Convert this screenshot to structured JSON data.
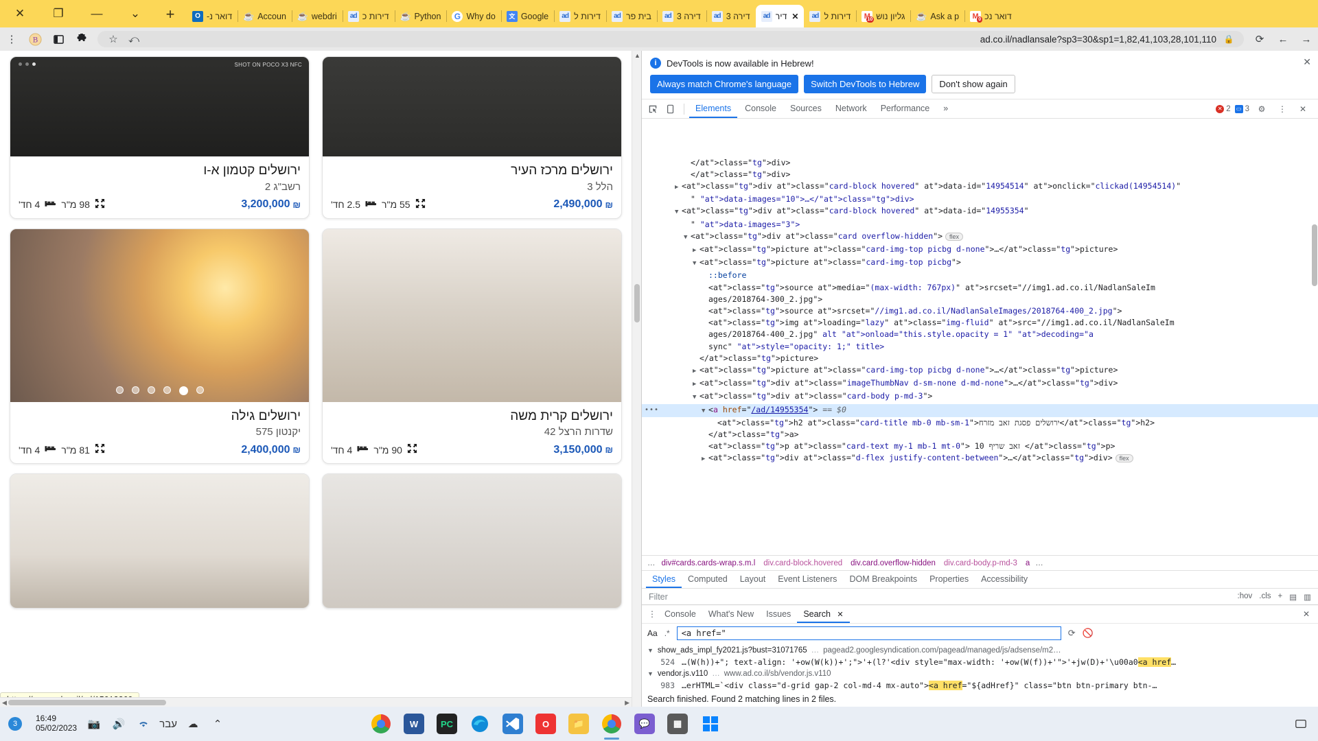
{
  "browser": {
    "window_controls": [
      "close-x",
      "restore",
      "minimize",
      "chevron"
    ],
    "new_tab_label": "+",
    "tabs": [
      {
        "label": "דואר נ-",
        "icon": "outlook-icon",
        "active": false
      },
      {
        "label": "Accoun",
        "icon": "java-icon",
        "active": false
      },
      {
        "label": "webdri",
        "icon": "java-icon",
        "active": false
      },
      {
        "label": "דירות כ",
        "icon": "ad-icon",
        "active": false
      },
      {
        "label": "Python",
        "icon": "java-icon",
        "active": false
      },
      {
        "label": "Why do",
        "icon": "google-icon",
        "active": false
      },
      {
        "label": "Google",
        "icon": "google-translate-icon",
        "active": false
      },
      {
        "label": "דירות ל",
        "icon": "ad-icon",
        "active": false
      },
      {
        "label": "בית פר",
        "icon": "ad-icon",
        "active": false
      },
      {
        "label": "דירה 3",
        "icon": "ad-icon",
        "active": false
      },
      {
        "label": "דירה 3",
        "icon": "ad-icon",
        "active": false
      },
      {
        "label": "דיר",
        "icon": "ad-icon",
        "active": true,
        "close": "✕"
      },
      {
        "label": "דירות ל",
        "icon": "ad-icon",
        "active": false
      },
      {
        "label": "גליון נוש",
        "icon": "gmail-icon",
        "badge": "10",
        "active": false
      },
      {
        "label": "Ask a p",
        "icon": "java-icon",
        "active": false
      },
      {
        "label": "דואר נכ",
        "icon": "gmail-icon",
        "badge": "0",
        "active": false
      }
    ],
    "toolbar_icons": [
      "kebab-menu-icon",
      "profile-icon",
      "sidepanel-icon",
      "extensions-icon",
      "star-icon",
      "share-icon"
    ],
    "url": "ad.co.il/nadlansale?sp3=30&sp1=1,82,41,103,28,101,110",
    "url_host": "ad.co.il",
    "url_path": "/nadlansale?sp3=30&sp1=1,82,41,103,28,101,110",
    "lock_icon": "lock-icon",
    "reload_icon": "reload-icon",
    "back_icon": "back-arrow-icon",
    "forward_icon": "forward-arrow-icon"
  },
  "page": {
    "status_link": "https://www.ad.co.il/ad/15013369",
    "cards": [
      {
        "title": "ירושלים מרכז העיר",
        "subtitle": "הלל 3",
        "price": "2,490,000",
        "currency": "₪",
        "rooms": "2.5 חד'",
        "size": "55 מ\"ר",
        "image": "img-kitchen-a",
        "expand_icon": "expand-icon",
        "bed_icon": "bed-icon"
      },
      {
        "title": "ירושלים קטמון א-ו",
        "subtitle": "רשב\"ג 2",
        "price": "3,200,000",
        "currency": "₪",
        "rooms": "4 חד'",
        "size": "98 מ\"ר",
        "image": "img-darkroom",
        "badge": "SHOT ON POCO X3 NFC",
        "expand_icon": "expand-icon",
        "bed_icon": "bed-icon"
      },
      {
        "title": "ירושלים קרית משה",
        "subtitle": "שדרות הרצל 42",
        "price": "3,150,000",
        "currency": "₪",
        "rooms": "4 חד'",
        "size": "90 מ\"ר",
        "image": "img-kitchen-b",
        "expand_icon": "expand-icon",
        "bed_icon": "bed-icon"
      },
      {
        "title": "ירושלים גילה",
        "subtitle": "יקנטון 575",
        "price": "2,400,000",
        "currency": "₪",
        "rooms": "4 חד'",
        "size": "81 מ\"ר",
        "image": "img-balcony",
        "dots": 6,
        "active_dot": 1,
        "expand_icon": "expand-icon",
        "bed_icon": "bed-icon"
      },
      {
        "title": "",
        "subtitle": "",
        "price": "",
        "image": "img-tiles"
      },
      {
        "title": "",
        "subtitle": "",
        "price": "",
        "image": "img-livingroom"
      }
    ]
  },
  "devtools": {
    "banner": {
      "message": "DevTools is now available in Hebrew!",
      "primary_button": "Always match Chrome's language",
      "secondary_button": "Switch DevTools to Hebrew",
      "dismiss_button": "Don't show again",
      "close_icon": "close-icon",
      "info_icon": "info-icon"
    },
    "tabs": [
      "Elements",
      "Console",
      "Sources",
      "Network",
      "Performance"
    ],
    "active_tab": "Elements",
    "overflow_icon": "chevron-right-icon",
    "inspect_icon": "inspect-icon",
    "device_icon": "device-toolbar-icon",
    "settings_icon": "gear-icon",
    "more_icon": "kebab-menu-icon",
    "close_icon": "close-icon",
    "error_count": "2",
    "message_count": "3",
    "dom_lines": [
      {
        "indent": 3,
        "twisty": "",
        "html": "&lt;/div&gt;",
        "type": "text"
      },
      {
        "indent": 3,
        "twisty": "",
        "html": "&lt;/div&gt;",
        "type": "text"
      },
      {
        "indent": 2,
        "twisty": "▶",
        "html": "&lt;div class=\"card-block hovered\" data-id=\"14954514\" onclick=\"clickad(14954514)\"",
        "type": "tag"
      },
      {
        "indent": 3,
        "twisty": "",
        "html": "\" data-images=\"10\"&gt;…&lt;/div&gt;",
        "type": "tag"
      },
      {
        "indent": 2,
        "twisty": "▼",
        "html": "&lt;div class=\"card-block hovered\" data-id=\"14955354\"",
        "type": "tag"
      },
      {
        "indent": 3,
        "twisty": "",
        "html": "\" data-images=\"3\"&gt;",
        "type": "tag"
      },
      {
        "indent": 3,
        "twisty": "▼",
        "html": "&lt;div class=\"card overflow-hidden\"&gt;",
        "type": "tag",
        "flex": true
      },
      {
        "indent": 4,
        "twisty": "▶",
        "html": "&lt;picture class=\"card-img-top picbg d-none\"&gt;…&lt;/picture&gt;",
        "type": "tag"
      },
      {
        "indent": 4,
        "twisty": "▼",
        "html": "&lt;picture class=\"card-img-top picbg\"&gt;",
        "type": "tag"
      },
      {
        "indent": 5,
        "twisty": "",
        "html": "::before",
        "type": "pseudo"
      },
      {
        "indent": 5,
        "twisty": "",
        "html": "&lt;source media=\"(max-width: 767px)\" srcset=\"//img1.ad.co.il/NadlanSaleIm",
        "type": "tag"
      },
      {
        "indent": 5,
        "twisty": "",
        "html": "ages/2018764-300_2.jpg\"&gt;",
        "type": "tag"
      },
      {
        "indent": 5,
        "twisty": "",
        "html": "&lt;source srcset=\"//img1.ad.co.il/NadlanSaleImages/2018764-400_2.jpg\"&gt;",
        "type": "tag"
      },
      {
        "indent": 5,
        "twisty": "",
        "html": "&lt;img loading=\"lazy\" class=\"img-fluid\" src=\"//img1.ad.co.il/NadlanSaleIm",
        "type": "tag"
      },
      {
        "indent": 5,
        "twisty": "",
        "html": "ages/2018764-400_2.jpg\" alt onload=\"this.style.opacity = 1\" decoding=\"a",
        "type": "tag"
      },
      {
        "indent": 5,
        "twisty": "",
        "html": "sync\" style=\"opacity: 1;\" title&gt;",
        "type": "tag"
      },
      {
        "indent": 4,
        "twisty": "",
        "html": "&lt;/picture&gt;",
        "type": "text"
      },
      {
        "indent": 4,
        "twisty": "▶",
        "html": "&lt;picture class=\"card-img-top picbg d-none\"&gt;…&lt;/picture&gt;",
        "type": "tag"
      },
      {
        "indent": 4,
        "twisty": "▶",
        "html": "&lt;div class=\"imageThumbNav d-sm-none d-md-none\"&gt;…&lt;/div&gt;",
        "type": "tag"
      },
      {
        "indent": 4,
        "twisty": "▼",
        "html": "&lt;div class=\"card-body p-md-3\"&gt;",
        "type": "tag"
      },
      {
        "indent": 5,
        "twisty": "▼",
        "html": "&lt;a href=\"/ad/14955354\"&gt; == $0",
        "type": "selected"
      },
      {
        "indent": 6,
        "twisty": "",
        "html": "&lt;h2 class=\"card-title mb-0 mb-sm-1\"&gt;ירושלים פסגת זאב מזרח&lt;/h2&gt;",
        "type": "tag"
      },
      {
        "indent": 5,
        "twisty": "",
        "html": "&lt;/a&gt;",
        "type": "text"
      },
      {
        "indent": 5,
        "twisty": "",
        "html": "&lt;p class=\"card-text my-1 mb-1 mt-0\"&gt; 10 זאב שריף &lt;/p&gt;",
        "type": "tag"
      },
      {
        "indent": 5,
        "twisty": "▶",
        "html": "&lt;div class=\"d-flex justify-content-between\"&gt;…&lt;/div&gt;",
        "type": "tag",
        "flex": true
      }
    ],
    "breadcrumbs": [
      "div#cards.cards-wrap.s.m.l",
      "div.card-block.hovered",
      "div.card.overflow-hidden",
      "div.card-body.p-md-3",
      "a"
    ],
    "breadcrumb_overflow": "…",
    "style_tabs": [
      "Styles",
      "Computed",
      "Layout",
      "Event Listeners",
      "DOM Breakpoints",
      "Properties",
      "Accessibility"
    ],
    "style_active_tab": "Styles",
    "filter_placeholder": "Filter",
    "hov_label": ":hov",
    "cls_label": ".cls",
    "plus_label": "+",
    "drawer_tabs": [
      "Console",
      "What's New",
      "Issues",
      "Search"
    ],
    "drawer_active_tab": "Search",
    "drawer_close_icon": "close-icon",
    "search": {
      "match_case_icon": "Aa",
      "regex_icon": ".*",
      "query": "<a href=\"",
      "refresh_icon": "refresh-icon",
      "clear_icon": "clear-icon"
    },
    "results": [
      {
        "file": "show_ads_impl_fy2021.js?bust=31071765",
        "url": "pagead2.googlesyndication.com/pagead/managed/js/adsense/m2…",
        "line_no": "524",
        "code_before": "…(W(h))+\"; text-align: '+ow(W(k))+';\">'+(l?'<div style=\"max-width: '+ow(W(f))+'\">'+jw(D)+'\\u00a0",
        "code_hl": "<a href",
        "code_after": "…"
      },
      {
        "file": "vendor.js.v110",
        "url": "www.ad.co.il/sb/vendor.js.v110",
        "line_no": "983",
        "code_before": "…erHTML=`<div class=\"d-grid gap-2 col-md-4 mx-auto\">",
        "code_hl": "<a href",
        "code_after": "=\"${adHref}\" class=\"btn btn-primary btn-…"
      }
    ],
    "search_status": "Search finished. Found 2 matching lines in 2 files."
  },
  "taskbar": {
    "time": "16:49",
    "date": "05/02/2023",
    "notification_count": "3",
    "language": "עבר",
    "icons": [
      "camera-icon",
      "volume-icon",
      "wifi-icon",
      "cloud-icon",
      "chevron-up-icon"
    ],
    "apps": [
      "chrome-icon",
      "word-icon",
      "pycharm-icon",
      "edge-icon",
      "vscode-icon",
      "opera-icon",
      "folder-icon",
      "chrome-active-icon",
      "chat-icon",
      "calculator-icon",
      "windows-icon"
    ],
    "right_icon": "notification-center-icon"
  }
}
